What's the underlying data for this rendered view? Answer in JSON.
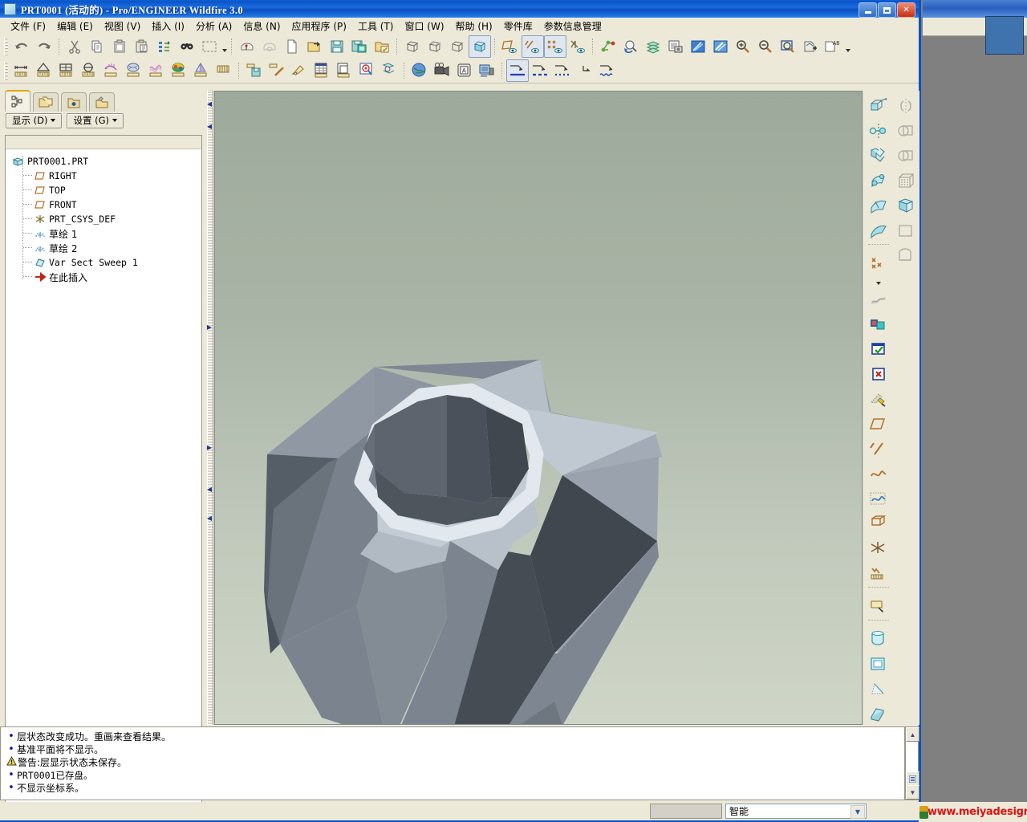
{
  "window": {
    "title": "PRT0001 (活动的) - Pro/ENGINEER Wildfire 3.0",
    "icon": "part-icon",
    "minimize": "-",
    "maximize": "□",
    "close": "✕"
  },
  "background_window": {
    "minimize": "-",
    "maximize": "□",
    "close": "✕"
  },
  "menubar": {
    "items": [
      {
        "label": "文件 (F)",
        "name": "menu-file"
      },
      {
        "label": "编辑 (E)",
        "name": "menu-edit"
      },
      {
        "label": "视图 (V)",
        "name": "menu-view"
      },
      {
        "label": "插入 (I)",
        "name": "menu-insert"
      },
      {
        "label": "分析 (A)",
        "name": "menu-analysis"
      },
      {
        "label": "信息 (N)",
        "name": "menu-info"
      },
      {
        "label": "应用程序 (P)",
        "name": "menu-applications"
      },
      {
        "label": "工具 (T)",
        "name": "menu-tools"
      },
      {
        "label": "窗口 (W)",
        "name": "menu-window"
      },
      {
        "label": "帮助 (H)",
        "name": "menu-help"
      },
      {
        "label": "零件库",
        "name": "menu-part-library"
      },
      {
        "label": "参数信息管理",
        "name": "menu-parameter-info"
      }
    ]
  },
  "toolbar_row1": {
    "icons": [
      "undo-icon",
      "redo-icon",
      "cut-icon",
      "copy-icon",
      "paste-icon",
      "paste-special-icon",
      "regenerate-icon",
      "find-icon",
      "select-box-icon",
      "select-dropdown-icon",
      "new-session-icon",
      "close-window-icon",
      "new-file-icon",
      "open-file-icon",
      "save-icon",
      "save-a-copy-icon",
      "backup-icon",
      "repaint-icon",
      "shade-wireframe-icon",
      "hidden-line-icon",
      "shaded-icon",
      "datum-plane-visibility-icon",
      "datum-axis-visibility-icon",
      "datum-point-visibility-icon",
      "datum-csys-visibility-icon",
      "spin-center-icon",
      "reorient-icon",
      "layers-icon",
      "model-tree-icon",
      "appearance-icon",
      "color-appearance-icon",
      "zoom-in-icon",
      "zoom-out-icon",
      "refit-icon",
      "insert-mode-icon",
      "annotation-icon"
    ]
  },
  "toolbar_row2": {
    "icons": [
      "measure-distance-icon",
      "measure-angle-icon",
      "measure-area-icon",
      "measure-diameter-icon",
      "curvature-icon",
      "surface-analysis-icon",
      "section-analysis-icon",
      "shaded-curvature-icon",
      "draft-analysis-icon",
      "analysis-info-icon",
      "save-analysis-icon",
      "delete-analysis-icon",
      "highlight-icon",
      "table-analysis-icon",
      "compare-icon",
      "inspect-icon",
      "geometry-check-icon",
      "global-interference-icon",
      "playback-icon",
      "annotate-icon",
      "model-player-icon",
      "style-solid-icon",
      "style-dashed-icon",
      "style-dotted-icon",
      "style-phantom-icon",
      "style-wavy-icon"
    ]
  },
  "model_tree": {
    "tabs": [
      {
        "name": "tab-model-tree",
        "icon": "model-tree-icon",
        "active": true
      },
      {
        "name": "tab-folder-browser",
        "icon": "folder-browser-icon",
        "active": false
      },
      {
        "name": "tab-favorites",
        "icon": "favorites-folder-icon",
        "active": false
      },
      {
        "name": "tab-connections",
        "icon": "tools-folder-icon",
        "active": false
      }
    ],
    "buttons": [
      {
        "label": "显示 (D)",
        "name": "tree-show-button"
      },
      {
        "label": "设置 (G)",
        "name": "tree-settings-button"
      }
    ],
    "nodes": [
      {
        "label": "PRT0001.PRT",
        "icon": "part-icon",
        "depth": 0,
        "cjk": false
      },
      {
        "label": "RIGHT",
        "icon": "datum-plane-icon",
        "depth": 1,
        "cjk": false
      },
      {
        "label": "TOP",
        "icon": "datum-plane-icon",
        "depth": 1,
        "cjk": false
      },
      {
        "label": "FRONT",
        "icon": "datum-plane-icon",
        "depth": 1,
        "cjk": false
      },
      {
        "label": "PRT_CSYS_DEF",
        "icon": "coordinate-system-icon",
        "depth": 1,
        "cjk": false
      },
      {
        "label": "草绘 1",
        "icon": "sketch-icon",
        "depth": 1,
        "cjk": true
      },
      {
        "label": "草绘 2",
        "icon": "sketch-icon",
        "depth": 1,
        "cjk": true
      },
      {
        "label": "Var Sect Sweep 1",
        "icon": "sweep-feature-icon",
        "depth": 1,
        "cjk": false
      },
      {
        "label": "在此插入",
        "icon": "insert-here-arrow-icon",
        "depth": 1,
        "cjk": true
      }
    ]
  },
  "right_toolbar": {
    "column_a": [
      "extrude-icon",
      "revolve-icon",
      "sweep-icon",
      "blend-icon",
      "variable-sweep-icon",
      "swept-blend-icon",
      "separator",
      "datum-point-icon",
      "separator2",
      "cosmetic-thread-icon",
      "user-defined-feature-icon",
      "resume-icon",
      "delete-icon",
      "edit-definition-icon",
      "datum-plane-icon",
      "datum-axis-icon",
      "datum-curve-icon",
      "datum-point-sketched-icon",
      "datum-coordinate-icon",
      "csys-icon",
      "graph-icon",
      "separator3",
      "offset-plane-icon",
      "separator4",
      "hole-icon",
      "shell-icon",
      "draft-icon",
      "rib-icon",
      "round-icon",
      "chamfer-icon"
    ],
    "column_b": [
      "mirror-icon",
      "merge-icon",
      "trim-icon",
      "pattern-icon",
      "fill-icon",
      "flat-surface-icon",
      "boundary-blend-icon"
    ]
  },
  "graphics": {
    "background_top": "#9eaa9c",
    "background_bottom": "#cfd6c8",
    "model_name": "var-section-sweep-solid"
  },
  "messages": [
    {
      "type": "info",
      "text": "层状态改变成功。重画来查看结果。",
      "mono": false
    },
    {
      "type": "info",
      "text": "基准平面将不显示。",
      "mono": false
    },
    {
      "type": "warning",
      "text": "警告:层显示状态未保存。",
      "mono": false
    },
    {
      "type": "info",
      "text": "PRT0001已存盘。",
      "mono": false
    },
    {
      "type": "info",
      "text": "不显示坐标系。",
      "mono": false
    }
  ],
  "statusbar": {
    "filter_value": "智能",
    "filter_name": "selection-filter-select"
  },
  "watermark": {
    "text": "www.meiyadesign.com",
    "color": "#e01010"
  }
}
